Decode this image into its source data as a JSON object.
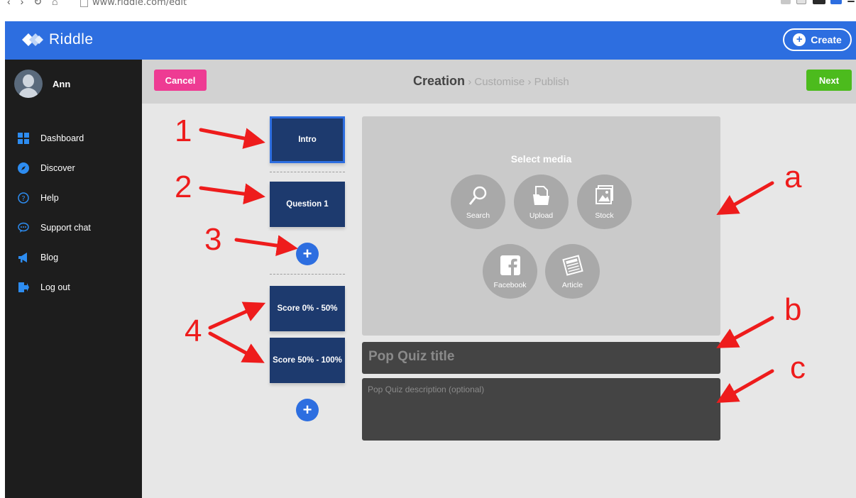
{
  "browser": {
    "url": "www.riddle.com/edit"
  },
  "appbar": {
    "logo_text": "Riddle",
    "create_label": "Create",
    "accent": "#2d6ee0"
  },
  "sidebar": {
    "username": "Ann",
    "items": [
      {
        "label": "Dashboard",
        "icon": "grid-icon"
      },
      {
        "label": "Discover",
        "icon": "compass-icon"
      },
      {
        "label": "Help",
        "icon": "help-icon"
      },
      {
        "label": "Support chat",
        "icon": "chat-icon"
      },
      {
        "label": "Blog",
        "icon": "megaphone-icon"
      },
      {
        "label": "Log out",
        "icon": "logout-icon"
      }
    ]
  },
  "toolbar": {
    "cancel_label": "Cancel",
    "next_label": "Next",
    "steps": {
      "active": "Creation",
      "second": "Customise",
      "third": "Publish",
      "separator": "›"
    }
  },
  "slides": {
    "intro": "Intro",
    "question": "Question 1",
    "results": [
      "Score 0% - 50%",
      "Score 50% - 100%"
    ],
    "add_symbol": "+"
  },
  "media": {
    "title": "Select media",
    "options": [
      "Search",
      "Upload",
      "Stock",
      "Facebook",
      "Article"
    ]
  },
  "form": {
    "title_placeholder": "Pop Quiz title",
    "description_placeholder": "Pop Quiz description (optional)"
  },
  "annotations": {
    "numbers": [
      "1",
      "2",
      "3",
      "4"
    ],
    "letters": [
      "a",
      "b",
      "c"
    ],
    "color": "#ee1c1c"
  },
  "colors": {
    "cancel": "#ee3b93",
    "next": "#4cbb1d",
    "card": "#1d3a6e",
    "sidebar": "#1d1d1d"
  }
}
